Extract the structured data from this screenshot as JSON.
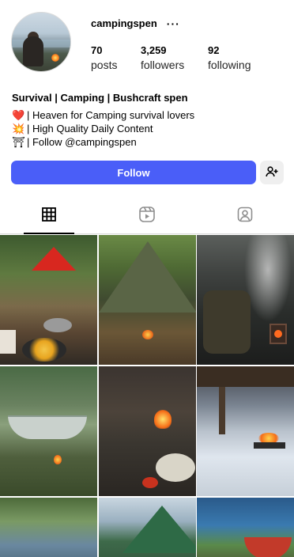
{
  "profile": {
    "username": "campingspen",
    "more_label": "···",
    "stats": {
      "posts_count": "70",
      "posts_label": "posts",
      "followers_count": "3,259",
      "followers_label": "followers",
      "following_count": "92",
      "following_label": "following"
    },
    "bio": {
      "title": "Survival | Camping | Bushcraft spen",
      "lines": [
        {
          "emoji": "❤️",
          "text": "| Heaven for Camping survival lovers"
        },
        {
          "emoji": "💥",
          "text": "| High Quality Daily Content"
        },
        {
          "emoji": "⛩",
          "text": "| Follow @campingspen"
        }
      ]
    }
  },
  "actions": {
    "follow_label": "Follow",
    "add_user_icon": "person-plus-icon"
  },
  "tabs": [
    {
      "icon": "grid-icon",
      "active": true
    },
    {
      "icon": "reels-icon",
      "active": false
    },
    {
      "icon": "tagged-icon",
      "active": false
    }
  ],
  "colors": {
    "follow_button": "#4a5ef8",
    "secondary_button": "#efefef"
  },
  "grid": {
    "posts": [
      "red tent camp breakfast",
      "tarp shelter campsite",
      "backpack smoking stove",
      "forest hammock campfire",
      "campfire food plate",
      "snowy mountain fire pit",
      "forest stream",
      "green tent",
      "lake kayak"
    ]
  }
}
